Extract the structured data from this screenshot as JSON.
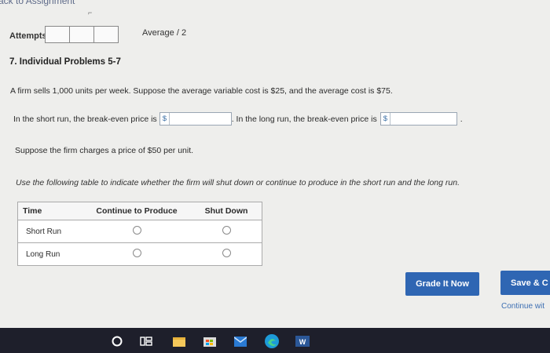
{
  "nav": {
    "back_label": "ack to Assignment"
  },
  "attempts": {
    "label": "Attempts",
    "average": "Average / 2"
  },
  "problem": {
    "title": "7. Individual Problems 5-7",
    "intro": "A firm sells 1,000 units per week. Suppose the average variable cost is $25, and the average cost is $75.",
    "short_run_text": "In the short run, the break-even price is",
    "long_run_text": ". In the long run, the break-even price is",
    "currency": "$",
    "end_period": ".",
    "price_text": "Suppose the firm charges a price of $50 per unit.",
    "table_instructions": "Use the following table to indicate whether the firm will shut down or continue to produce in the short run and the long run."
  },
  "table": {
    "headers": [
      "Time",
      "Continue to Produce",
      "Shut Down"
    ],
    "rows": [
      {
        "label": "Short Run"
      },
      {
        "label": "Long Run"
      }
    ]
  },
  "buttons": {
    "grade": "Grade It Now",
    "save": "Save & C",
    "continue": "Continue wit"
  },
  "colors": {
    "primary_button": "#2f66b3",
    "taskbar": "#1e1f2b"
  },
  "taskbar_icons": [
    "cortana-icon",
    "task-view-icon",
    "file-explorer-icon",
    "store-icon",
    "mail-icon",
    "edge-icon",
    "word-icon"
  ]
}
